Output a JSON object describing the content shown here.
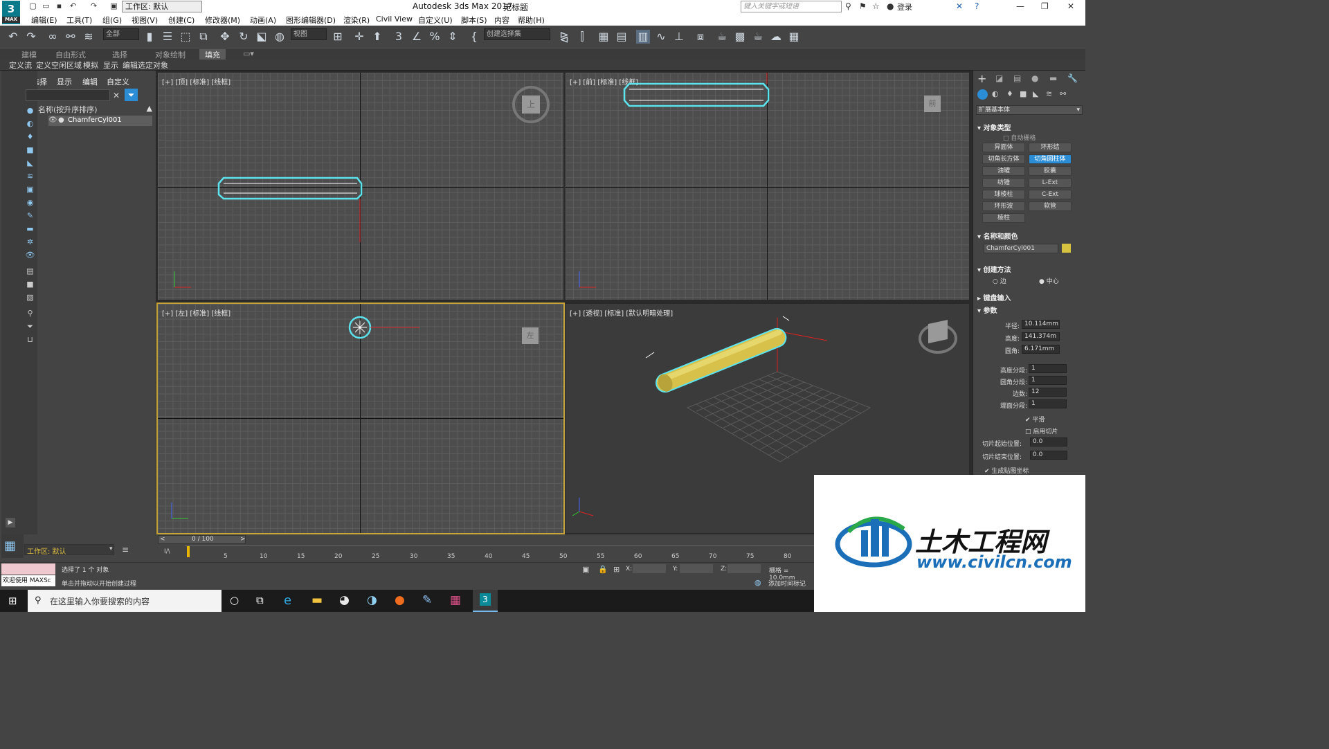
{
  "titlebar": {
    "logo": "3",
    "logo_sub": "MAX",
    "workspace": "工作区: 默认",
    "app_title": "Autodesk 3ds Max 2017",
    "doc_title": "无标题",
    "search_placeholder": "键入关键字或短语",
    "login": "登录"
  },
  "menu": [
    "编辑(E)",
    "工具(T)",
    "组(G)",
    "视图(V)",
    "创建(C)",
    "修改器(M)",
    "动画(A)",
    "图形编辑器(D)",
    "渲染(R)",
    "Civil View",
    "自定义(U)",
    "脚本(S)",
    "内容",
    "帮助(H)"
  ],
  "toolbar": {
    "filter": "全部",
    "refcoord": "视图",
    "selection_set": "创建选择集"
  },
  "ribbon": {
    "tabs": [
      "建模",
      "自由形式",
      "选择",
      "对象绘制",
      "填充"
    ],
    "active_tab": "填充",
    "sub": [
      "定义流",
      "定义空闲区域",
      "模拟",
      "显示",
      "编辑选定对象"
    ]
  },
  "scene_explorer": {
    "tabs": [
      "选择",
      "显示",
      "编辑",
      "自定义"
    ],
    "column_header": "名称(按升序排序)",
    "rows": [
      {
        "name": "ChamferCyl001"
      }
    ]
  },
  "viewports": {
    "top": "[+] [顶] [标准] [线框]",
    "front": "[+] [前] [标准] [线框]",
    "left": "[+] [左] [标准] [线框]",
    "persp": "[+] [透视] [标准] [默认明暗处理]",
    "cube_top": "上",
    "cube_front": "前",
    "cube_left": "左"
  },
  "command_panel": {
    "category": "扩展基本体",
    "object_type_title": "对象类型",
    "autogrid": "自动栅格",
    "buttons": [
      [
        "异面体",
        "环形结"
      ],
      [
        "切角长方体",
        "切角圆柱体"
      ],
      [
        "油罐",
        "胶囊"
      ],
      [
        "纺锤",
        "L-Ext"
      ],
      [
        "球棱柱",
        "C-Ext"
      ],
      [
        "环形波",
        "软管"
      ],
      [
        "棱柱",
        ""
      ]
    ],
    "active_button": "切角圆柱体",
    "name_color_title": "名称和颜色",
    "object_name": "ChamferCyl001",
    "object_color": "#d8c340",
    "creation_method_title": "创建方法",
    "method_edge": "边",
    "method_center": "中心",
    "keyboard_title": "键盘输入",
    "params_title": "参数",
    "params": [
      {
        "label": "半径:",
        "value": "10.114mm"
      },
      {
        "label": "高度:",
        "value": "141.374m"
      },
      {
        "label": "圆角:",
        "value": "6.171mm"
      }
    ],
    "segs": [
      {
        "label": "高度分段:",
        "value": "1"
      },
      {
        "label": "圆角分段:",
        "value": "1"
      },
      {
        "label": "边数:",
        "value": "12"
      },
      {
        "label": "端面分段:",
        "value": "1"
      }
    ],
    "smooth": "平滑",
    "slice_on": "启用切片",
    "slice_from_label": "切片起始位置:",
    "slice_from": "0.0",
    "slice_to_label": "切片结束位置:",
    "slice_to": "0.0",
    "gen_uv": "生成贴图坐标"
  },
  "timeline": {
    "frame": "0 / 100",
    "ticks": [
      5,
      10,
      15,
      20,
      25,
      30,
      35,
      40,
      45,
      50,
      55,
      60,
      65,
      70,
      75,
      80
    ],
    "prefix": "I/\\"
  },
  "status": {
    "workspace": "工作区: 默认",
    "welcome": "欢迎使用 MAXSc",
    "selected": "选择了 1 个 对象",
    "hint": "单击并拖动以开始创建过程",
    "x": "X:",
    "y": "Y:",
    "z": "Z:",
    "grid": "栅格 = 10.0mm",
    "add_time_tag": "添加时间标记"
  },
  "taskbar": {
    "search": "在这里输入你要搜索的内容"
  },
  "watermark": {
    "brand": "土木工程网",
    "url": "www.civilcn.com"
  }
}
